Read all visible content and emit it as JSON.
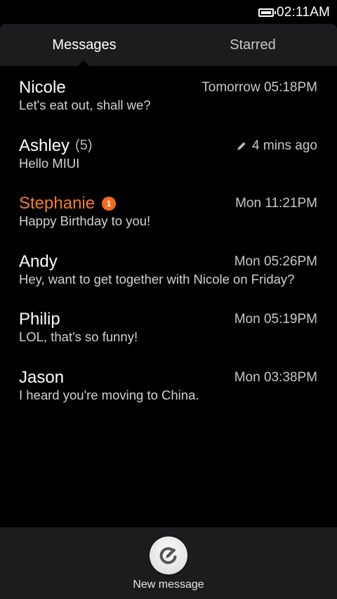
{
  "status_bar": {
    "time": "02:11AM",
    "battery_icon": "battery-icon"
  },
  "tabs": [
    {
      "label": "Messages",
      "active": true
    },
    {
      "label": "Starred",
      "active": false
    }
  ],
  "messages": [
    {
      "sender": "Nicole",
      "count": "",
      "badge": "",
      "draft": false,
      "timestamp": "Tomorrow 05:18PM",
      "snippet": "Let's eat out, shall we?",
      "unread": false
    },
    {
      "sender": "Ashley",
      "count": "(5)",
      "badge": "",
      "draft": true,
      "timestamp": "4 mins ago",
      "snippet": "Hello MIUI",
      "unread": false
    },
    {
      "sender": "Stephanie",
      "count": "",
      "badge": "1",
      "draft": false,
      "timestamp": "Mon 11:21PM",
      "snippet": "Happy Birthday to you!",
      "unread": true
    },
    {
      "sender": "Andy",
      "count": "",
      "badge": "",
      "draft": false,
      "timestamp": "Mon 05:26PM",
      "snippet": "Hey, want to get together with Nicole on Friday?",
      "unread": false
    },
    {
      "sender": "Philip",
      "count": "",
      "badge": "",
      "draft": false,
      "timestamp": "Mon 05:19PM",
      "snippet": "LOL, that's so funny!",
      "unread": false
    },
    {
      "sender": "Jason",
      "count": "",
      "badge": "",
      "draft": false,
      "timestamp": "Mon 03:38PM",
      "snippet": "I heard you're moving to China.",
      "unread": false
    }
  ],
  "bottom_bar": {
    "new_message_label": "New message",
    "new_message_icon": "compose-icon"
  },
  "colors": {
    "accent_unread": "#f57c1f",
    "badge": "#f26b1d",
    "bar_background": "#1c1c1e",
    "background": "#000000"
  }
}
